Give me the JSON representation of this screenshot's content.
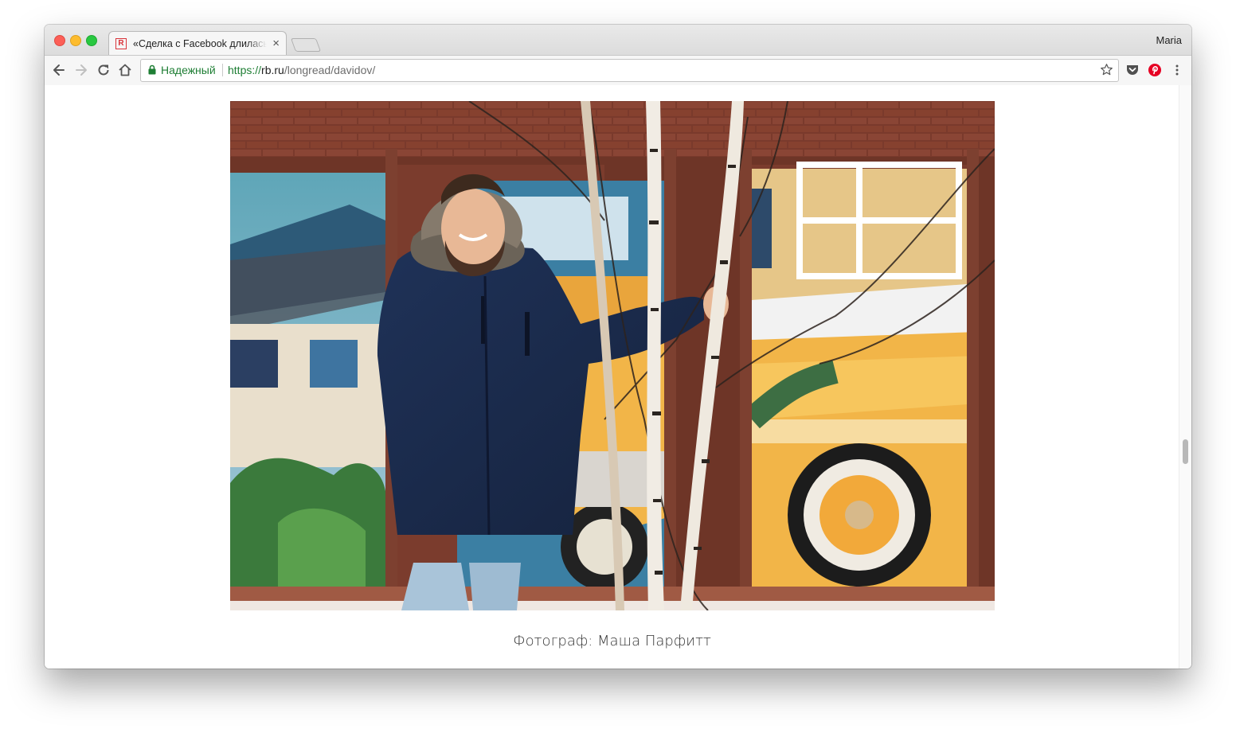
{
  "browser": {
    "tab": {
      "favicon_letter": "R",
      "title": "«Сделка с Facebook длилась"
    },
    "profile_name": "Maria",
    "address": {
      "secure_label": "Надежный",
      "url_scheme": "https://",
      "url_host": "rb.ru",
      "url_path": "/longread/davidov/"
    },
    "toolbar_icons": [
      "back-icon",
      "forward-icon",
      "reload-icon",
      "home-icon",
      "bookmark-star-icon",
      "pocket-icon",
      "pinterest-icon",
      "menu-icon"
    ]
  },
  "article": {
    "photo_alt": "Портрет мужчины в синей парке у стены с граффити",
    "caption": "Фотограф: Маша Парфитт"
  },
  "colors": {
    "secure_green": "#1e7e34",
    "favicon_red": "#d9343a",
    "pinterest_red": "#e60023"
  }
}
